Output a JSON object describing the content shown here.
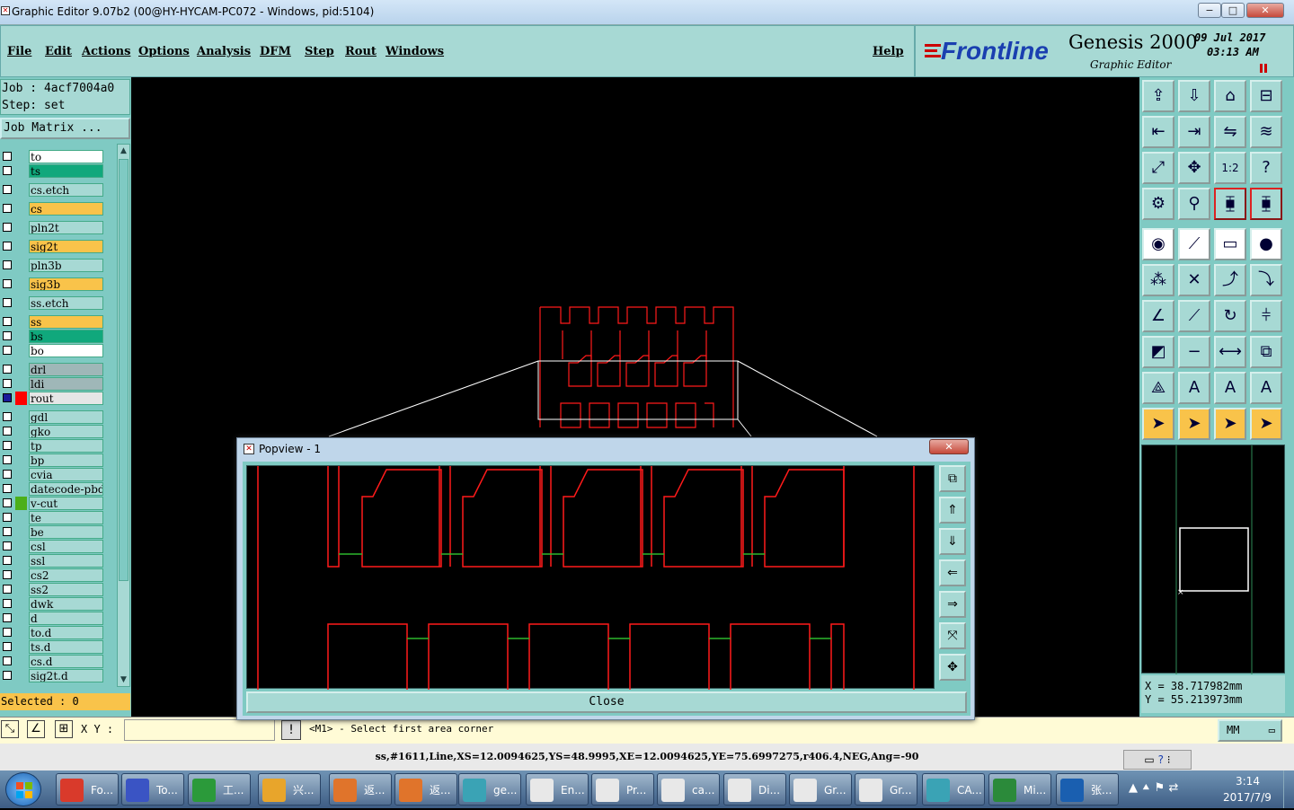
{
  "window": {
    "title": "Graphic Editor 9.07b2 (00@HY-HYCAM-PC072 - Windows, pid:5104)",
    "min": "−",
    "max": "□",
    "close": "✕"
  },
  "menu": {
    "items": [
      "File",
      "Edit",
      "Actions",
      "Options",
      "Analysis",
      "DFM",
      "Step",
      "Rout",
      "Windows"
    ],
    "help": "Help"
  },
  "brand": {
    "logo": "Frontline",
    "product": "Genesis 2000",
    "subtitle": "Graphic Editor",
    "date": "09 Jul 2017",
    "time": "03:13 AM"
  },
  "job": {
    "job_label": "Job : 4acf7004a0",
    "step_label": "Step: set",
    "matrix_button": "Job Matrix ..."
  },
  "layers": [
    {
      "name": "to",
      "color": "#ffffff"
    },
    {
      "name": "ts",
      "color": "#10a87c"
    },
    {
      "name": "cs.etch",
      "color": "#a7d9d4"
    },
    {
      "name": "cs",
      "color": "#f9c34a"
    },
    {
      "name": "pln2t",
      "color": "#a7d9d4"
    },
    {
      "name": "sig2t",
      "color": "#f9c34a"
    },
    {
      "name": "pln3b",
      "color": "#a7d9d4"
    },
    {
      "name": "sig3b",
      "color": "#f9c34a"
    },
    {
      "name": "ss.etch",
      "color": "#a7d9d4"
    },
    {
      "name": "ss",
      "color": "#f9c34a"
    },
    {
      "name": "bs",
      "color": "#10a87c"
    },
    {
      "name": "bo",
      "color": "#ffffff"
    },
    {
      "name": "drl",
      "color": "#9fb7b8"
    },
    {
      "name": "ldi",
      "color": "#9fb7b8"
    },
    {
      "name": "rout",
      "color": "#e6e6e6"
    },
    {
      "name": "gdl",
      "color": "#a7d9d4"
    },
    {
      "name": "gko",
      "color": "#a7d9d4"
    },
    {
      "name": "tp",
      "color": "#a7d9d4"
    },
    {
      "name": "bp",
      "color": "#a7d9d4"
    },
    {
      "name": "cvia",
      "color": "#a7d9d4"
    },
    {
      "name": "datecode-pbd",
      "color": "#a7d9d4"
    },
    {
      "name": "v-cut",
      "color": "#a7d9d4"
    },
    {
      "name": "te",
      "color": "#a7d9d4"
    },
    {
      "name": "be",
      "color": "#a7d9d4"
    },
    {
      "name": "csl",
      "color": "#a7d9d4"
    },
    {
      "name": "ssl",
      "color": "#a7d9d4"
    },
    {
      "name": "cs2",
      "color": "#a7d9d4"
    },
    {
      "name": "ss2",
      "color": "#a7d9d4"
    },
    {
      "name": "dwk",
      "color": "#a7d9d4"
    },
    {
      "name": "d",
      "color": "#a7d9d4"
    },
    {
      "name": "to.d",
      "color": "#a7d9d4"
    },
    {
      "name": "ts.d",
      "color": "#a7d9d4"
    },
    {
      "name": "cs.d",
      "color": "#a7d9d4"
    },
    {
      "name": "sig2t.d",
      "color": "#a7d9d4"
    }
  ],
  "selected": "Selected : 0",
  "popup": {
    "title": "Popview - 1",
    "close_label": "Close"
  },
  "coords": {
    "x": "X = 38.717982mm",
    "y": "Y = 55.213973mm"
  },
  "bottom": {
    "xy_label": "X Y :",
    "prompt": "<M1> - Select first area corner",
    "units": "MM"
  },
  "status_line": "ss,#1611,Line,XS=12.0094625,YS=48.9995,XE=12.0094625,YE=75.6997275,r406.4,NEG,Ang=-90",
  "taskbar": {
    "items": [
      "Fo...",
      "To...",
      "工...",
      "兴...",
      "返...",
      "返...",
      "ge...",
      "En...",
      "Pr...",
      "ca...",
      "Di...",
      "Gr...",
      "Gr...",
      "CA...",
      "Mi...",
      "张..."
    ],
    "clock_time": "3:14",
    "clock_date": "2017/7/9"
  }
}
